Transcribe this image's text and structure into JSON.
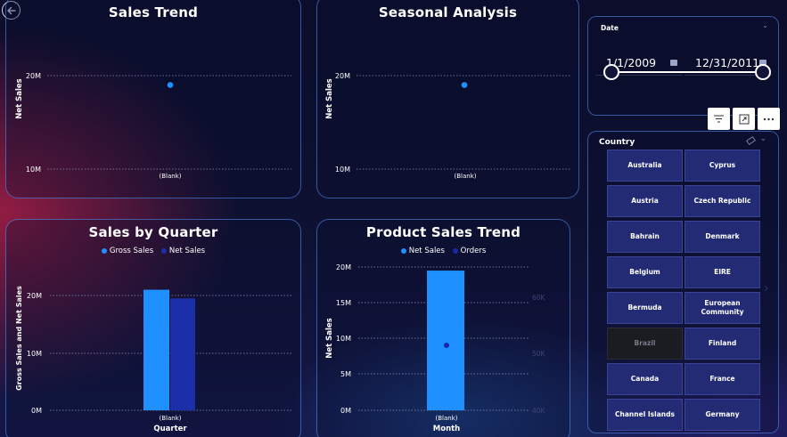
{
  "charts": {
    "sales_trend": {
      "title": "Sales Trend",
      "ylabel": "Net Sales",
      "ticks": [
        "20M",
        "10M"
      ],
      "category": "(Blank)"
    },
    "seasonal": {
      "title": "Seasonal Analysis",
      "ylabel": "Net Sales",
      "ticks": [
        "20M",
        "10M"
      ],
      "category": "(Blank)"
    },
    "quarter": {
      "title": "Sales by Quarter",
      "legend": [
        "Gross Sales",
        "Net Sales"
      ],
      "ylabel": "Gross Sales and Net Sales",
      "ticks": [
        "20M",
        "10M",
        "0M"
      ],
      "category": "(Blank)",
      "xlabel": "Quarter"
    },
    "product": {
      "title": "Product Sales Trend",
      "legend": [
        "Net Sales",
        "Orders"
      ],
      "ylabel": "Net Sales",
      "ticks": [
        "20M",
        "15M",
        "10M",
        "5M",
        "0M"
      ],
      "right_ticks": [
        "60K",
        "50K",
        "40K"
      ],
      "category": "(Blank)",
      "xlabel": "Month"
    }
  },
  "chart_data": [
    {
      "type": "scatter",
      "title": "Sales Trend",
      "xlabel": "",
      "ylabel": "Net Sales",
      "categories": [
        "(Blank)"
      ],
      "values": [
        19000000
      ],
      "ylim": [
        10000000,
        20000000
      ],
      "grid": true
    },
    {
      "type": "scatter",
      "title": "Seasonal Analysis",
      "xlabel": "",
      "ylabel": "Net Sales",
      "categories": [
        "(Blank)"
      ],
      "values": [
        19000000
      ],
      "ylim": [
        10000000,
        20000000
      ],
      "grid": true
    },
    {
      "type": "bar",
      "title": "Sales by Quarter",
      "xlabel": "Quarter",
      "ylabel": "Gross Sales and Net Sales",
      "categories": [
        "(Blank)"
      ],
      "series": [
        {
          "name": "Gross Sales",
          "values": [
            21000000
          ]
        },
        {
          "name": "Net Sales",
          "values": [
            19500000
          ]
        }
      ],
      "ylim": [
        0,
        20000000
      ],
      "legend": "top",
      "grid": true
    },
    {
      "type": "bar",
      "title": "Product Sales Trend",
      "xlabel": "Month",
      "ylabel": "Net Sales",
      "categories": [
        "(Blank)"
      ],
      "series": [
        {
          "name": "Net Sales",
          "values": [
            19500000
          ]
        },
        {
          "name": "Orders",
          "values": [
            51500
          ],
          "axis": "right",
          "type": "line"
        }
      ],
      "ylim": [
        0,
        20000000
      ],
      "right_ylim": [
        40000,
        60000
      ],
      "legend": "top",
      "grid": true
    }
  ],
  "date_slicer": {
    "title": "Date",
    "start": "1/1/2009",
    "end": "12/31/2011",
    "range": [
      0,
      1
    ]
  },
  "toolbar": {
    "icons": [
      "filter-icon",
      "focus-mode-icon",
      "more-options-icon"
    ]
  },
  "country_slicer": {
    "title": "Country",
    "items": [
      {
        "label": "Australia"
      },
      {
        "label": "Cyprus"
      },
      {
        "label": "Austria"
      },
      {
        "label": "Czech Republic"
      },
      {
        "label": "Bahrain"
      },
      {
        "label": "Denmark"
      },
      {
        "label": "Belgium"
      },
      {
        "label": "EIRE"
      },
      {
        "label": "Bermuda"
      },
      {
        "label": "European Community"
      },
      {
        "label": "Brazil",
        "state": "dimmed"
      },
      {
        "label": "Finland"
      },
      {
        "label": "Canada"
      },
      {
        "label": "France"
      },
      {
        "label": "Channel Islands"
      },
      {
        "label": "Germany"
      }
    ]
  },
  "colors": {
    "accent": "#1e90ff",
    "net_sales": "#1b2fa8",
    "orders": "#1a28a8",
    "border": "#5a96ff",
    "slicer_button": "#232b75",
    "slicer_button_dimmed": "#1b1b22"
  }
}
